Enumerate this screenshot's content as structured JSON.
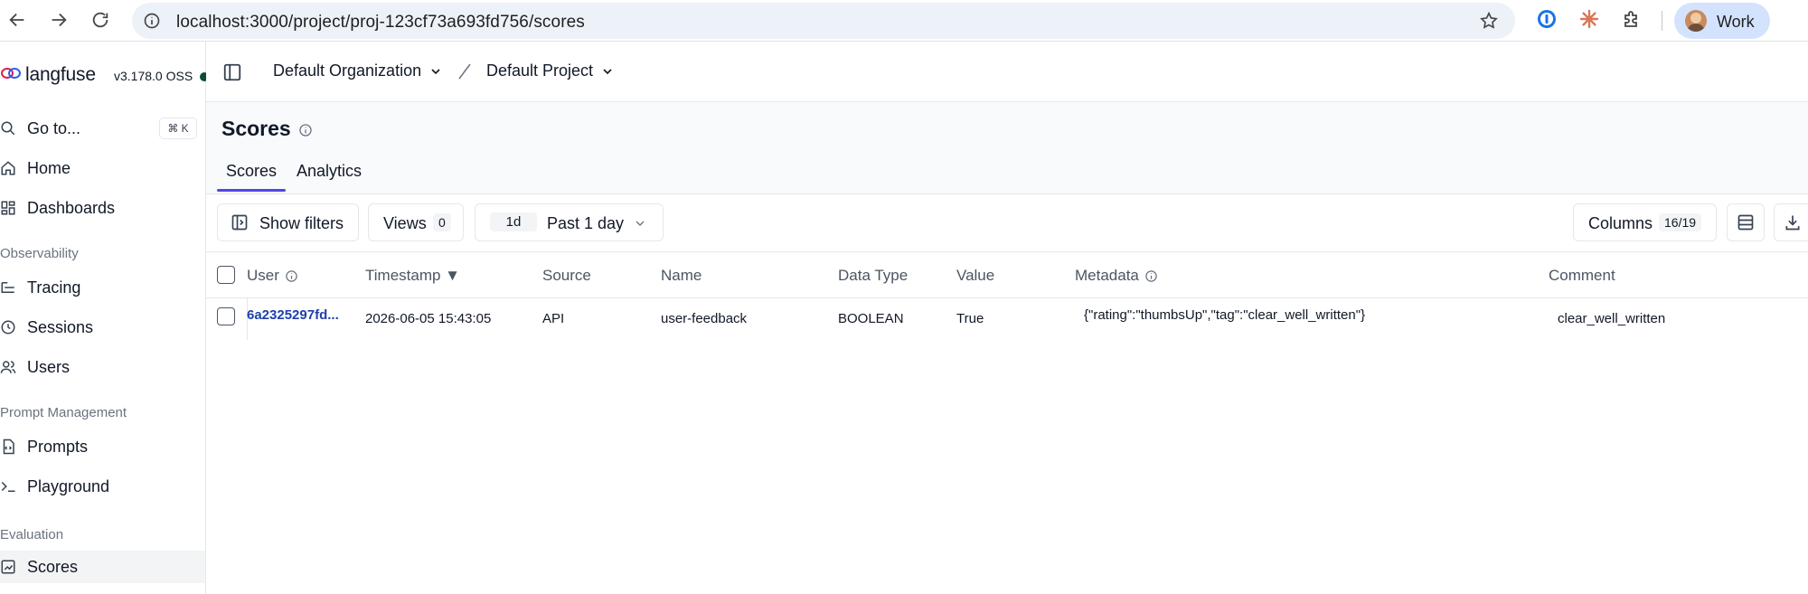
{
  "browser": {
    "url": "localhost:3000/project/proj-123cf73a693fd756/scores",
    "profile_label": "Work"
  },
  "sidebar": {
    "brand": "langfuse",
    "version": "v3.178.0 OSS",
    "goto": {
      "label": "Go to...",
      "shortcut": "⌘ K"
    },
    "items_top": [
      {
        "label": "Home",
        "icon": "home-icon"
      },
      {
        "label": "Dashboards",
        "icon": "dashboard-icon"
      }
    ],
    "sections": [
      {
        "label": "Observability",
        "items": [
          {
            "label": "Tracing",
            "icon": "tracing-icon"
          },
          {
            "label": "Sessions",
            "icon": "clock-icon"
          },
          {
            "label": "Users",
            "icon": "users-icon"
          }
        ]
      },
      {
        "label": "Prompt Management",
        "items": [
          {
            "label": "Prompts",
            "icon": "file-code-icon"
          },
          {
            "label": "Playground",
            "icon": "terminal-icon"
          }
        ]
      },
      {
        "label": "Evaluation",
        "items": [
          {
            "label": "Scores",
            "icon": "score-icon",
            "active": true
          }
        ]
      }
    ]
  },
  "header": {
    "organization": "Default Organization",
    "project": "Default Project"
  },
  "page": {
    "title": "Scores",
    "tabs": [
      {
        "label": "Scores",
        "active": true
      },
      {
        "label": "Analytics",
        "active": false
      }
    ]
  },
  "toolbar": {
    "filters_label": "Show filters",
    "views_label": "Views",
    "views_count": "0",
    "range_short": "1d",
    "range_label": "Past 1 day",
    "columns_label": "Columns",
    "columns_count": "16/19"
  },
  "table": {
    "columns": [
      "User",
      "Timestamp ▼",
      "Source",
      "Name",
      "Data Type",
      "Value",
      "Metadata",
      "Comment"
    ],
    "rows": [
      {
        "user": "6a2325297fd...",
        "timestamp": "2026-06-05 15:43:05",
        "source": "API",
        "name": "user-feedback",
        "data_type": "BOOLEAN",
        "value": "True",
        "metadata": "{\"rating\":\"thumbsUp\",\"tag\":\"clear_well_written\"}",
        "comment": "clear_well_written"
      }
    ]
  },
  "colors": {
    "accent": "#4f46e5",
    "link": "#1e40af"
  }
}
